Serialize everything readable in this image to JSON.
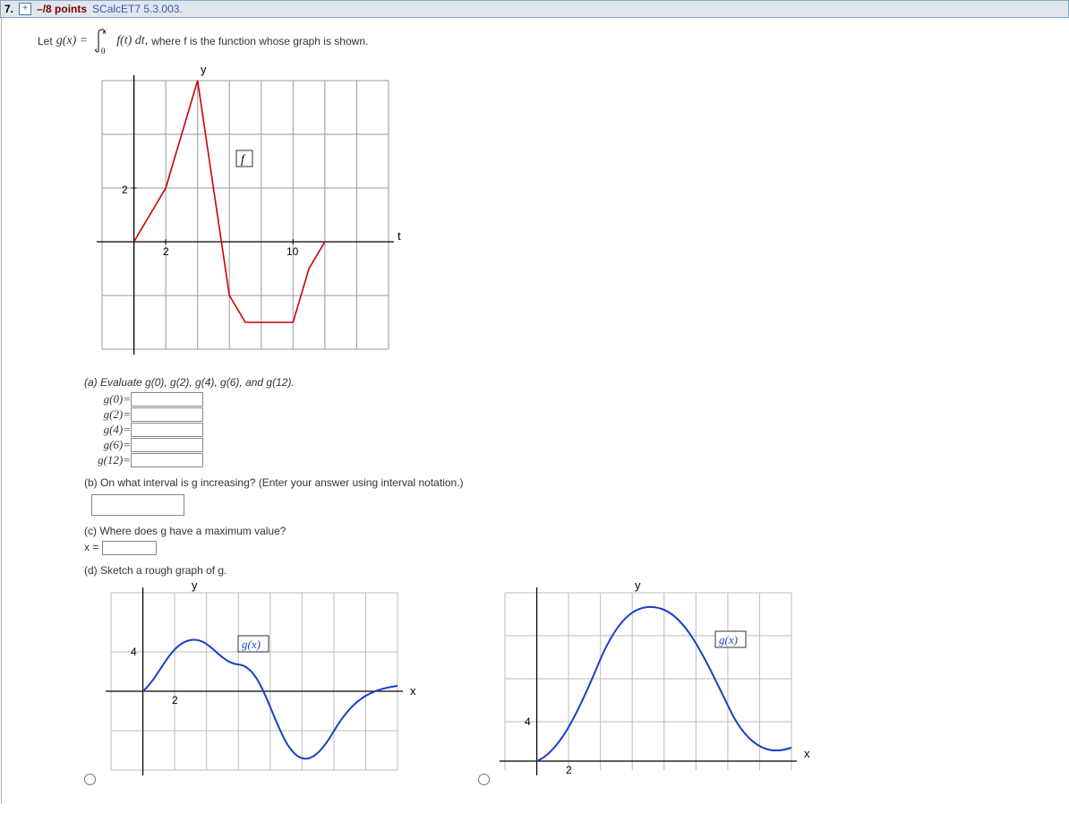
{
  "header": {
    "number": "7.",
    "points": "–/8 points",
    "ref": "SCalcET7 5.3.003."
  },
  "stmt": {
    "lead": "Let",
    "gx": "g(x) =",
    "int_top": "x",
    "int_bot": "0",
    "int_body": "f(t) dt,",
    "tail": "where f is the function whose graph is shown."
  },
  "graph": {
    "ylabel": "y",
    "xlabel": "t",
    "ytick": "2",
    "xtick1": "2",
    "xtick2": "10",
    "curve_label": "f"
  },
  "parts": {
    "a_text": "(a) Evaluate g(0), g(2), g(4), g(6), and g(12).",
    "a_rows": [
      {
        "label": "g(0)="
      },
      {
        "label": "g(2)="
      },
      {
        "label": "g(4)="
      },
      {
        "label": "g(6)="
      },
      {
        "label": "g(12)="
      }
    ],
    "b_text": "(b) On what interval is g increasing? (Enter your answer using interval notation.)",
    "c_text": "(c) Where does g have a maximum value?",
    "c_label": "x =",
    "d_text": "(d) Sketch a rough graph of g."
  },
  "thumbs": {
    "y": "y",
    "x": "x",
    "gx": "g(x)",
    "four": "4",
    "two": "2"
  },
  "chart_data": {
    "type": "line",
    "title": "Graph of f(t)",
    "xlabel": "t",
    "ylabel": "y",
    "x": [
      0,
      1,
      2,
      3,
      4,
      5,
      6,
      7,
      8,
      8,
      9,
      10,
      11,
      12
    ],
    "y": [
      0,
      1,
      2,
      4,
      6,
      2,
      -2,
      -3,
      -3,
      -3,
      -3,
      -3,
      -1,
      0
    ],
    "xlim": [
      -2,
      16
    ],
    "ylim": [
      -4,
      6
    ],
    "grid": true,
    "annotations": [
      {
        "x": 5,
        "y": 4,
        "text": "f"
      }
    ]
  }
}
